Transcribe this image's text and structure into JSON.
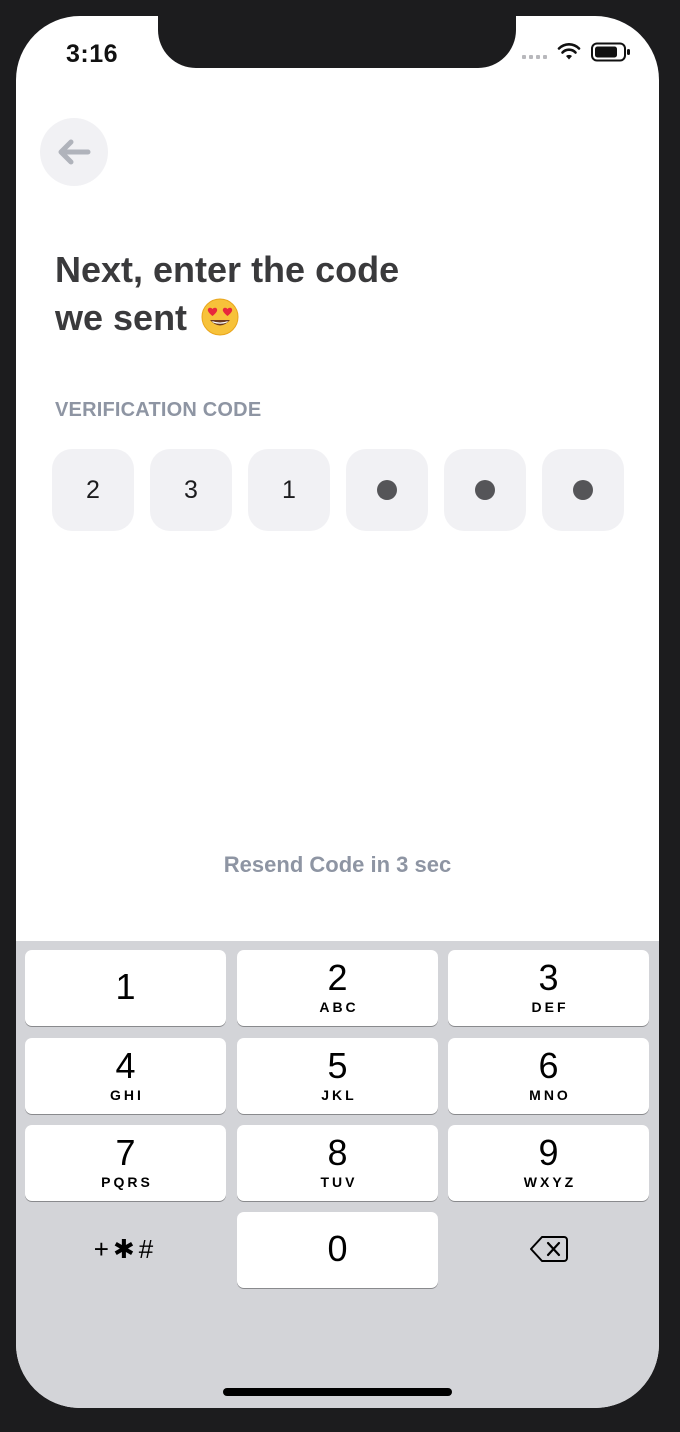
{
  "status_bar": {
    "time": "3:16",
    "icons": [
      "signal-icon",
      "wifi-icon",
      "battery-icon"
    ]
  },
  "nav": {
    "back_icon": "arrow-left-icon"
  },
  "heading": {
    "line1": "Next, enter the code",
    "line2": "we sent",
    "emoji": "heart-eyes-emoji"
  },
  "verification": {
    "label": "VERIFICATION CODE",
    "entered": [
      "2",
      "3",
      "1"
    ],
    "total_digits": 6
  },
  "resend": {
    "text": "Resend Code in 3 sec"
  },
  "keypad": {
    "keys": [
      {
        "digit": "1",
        "letters": ""
      },
      {
        "digit": "2",
        "letters": "ABC"
      },
      {
        "digit": "3",
        "letters": "DEF"
      },
      {
        "digit": "4",
        "letters": "GHI"
      },
      {
        "digit": "5",
        "letters": "JKL"
      },
      {
        "digit": "6",
        "letters": "MNO"
      },
      {
        "digit": "7",
        "letters": "PQRS"
      },
      {
        "digit": "8",
        "letters": "TUV"
      },
      {
        "digit": "9",
        "letters": "WXYZ"
      },
      {
        "digit": "0",
        "letters": ""
      }
    ],
    "symbols": "+✱#",
    "delete_icon": "backspace-icon"
  },
  "colors": {
    "heading": "#3a3a3c",
    "label": "#8e95a3",
    "box_bg": "#f1f1f4",
    "keyboard_bg": "#d3d4d8"
  }
}
